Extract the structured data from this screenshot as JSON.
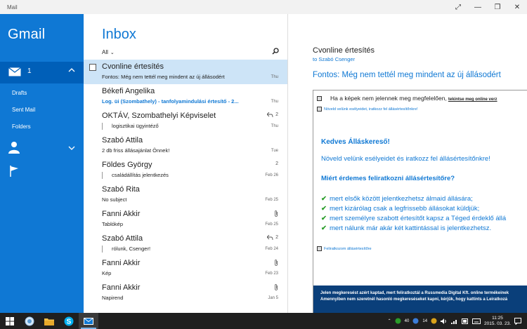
{
  "window": {
    "title": "Mail",
    "controls": [
      "⤢",
      "—",
      "❐",
      "✕"
    ]
  },
  "nav": {
    "account": "Gmail",
    "inbox_count": "1",
    "folders": [
      "Drafts",
      "Sent Mail",
      "Folders"
    ],
    "accent": "#0f78d4"
  },
  "list": {
    "heading": "Inbox",
    "filter": "All",
    "messages": [
      {
        "sender": "Cvonline értesítés",
        "subject": "Fontos: Még nem tettél meg mindent az új állásodért",
        "date": "Thu",
        "count": "",
        "selected": true,
        "unread": false
      },
      {
        "sender": "Békefi Angelika",
        "subject": "Log. üi (Szombathely) - tanfolyamindulási értesítő - 2...",
        "date": "Thu",
        "count": "",
        "selected": false,
        "unread": true
      },
      {
        "sender": "OKTÁV, Szombathelyi Képviselet",
        "subject": "logisztikai ügyintéző",
        "date": "Thu",
        "count": "2",
        "selected": false,
        "unread": false
      },
      {
        "sender": "Szabó Attila",
        "subject": "2 db friss állásajánlat Önnek!",
        "date": "Tue",
        "count": "",
        "selected": false,
        "unread": false
      },
      {
        "sender": "Földes György",
        "subject": "családállítás jelentkezés",
        "date": "Feb 26",
        "count": "2",
        "selected": false,
        "unread": false
      },
      {
        "sender": "Szabó Rita",
        "subject": "No subject",
        "date": "Feb 25",
        "count": "",
        "selected": false,
        "unread": false
      },
      {
        "sender": "Fanni Akkir",
        "subject": "Tablókép",
        "date": "Feb 25",
        "count": "",
        "selected": false,
        "unread": false
      },
      {
        "sender": "Szabó Attila",
        "subject": "rólunk, Csenger!",
        "date": "Feb 24",
        "count": "2",
        "selected": false,
        "unread": false
      },
      {
        "sender": "Fanni Akkir",
        "subject": "Kép",
        "date": "Feb 23",
        "count": "",
        "selected": false,
        "unread": false
      },
      {
        "sender": "Fanni Akkir",
        "subject": "Napirend",
        "date": "Jan 5",
        "count": "",
        "selected": false,
        "unread": false
      }
    ]
  },
  "reading": {
    "title": "Cvonline értesítés",
    "to": "to Szabó Csenger",
    "subject": "Fontos: Még nem tettél meg mindent az új állásodért",
    "email": {
      "image_note": "Ha a képek nem jelennek meg megfelelően,",
      "image_link": "tekintse meg online verz",
      "banner_link": "Növeld velünk esélyeidet, iratkozz fel állásértesítőnkre!",
      "greeting": "Kedves Álláskereső!",
      "para": "Növeld velünk esélyeidet és iratkozz fel állásértesítőnkre!",
      "why": "Miért érdemes feliratkozni állásértesítőre?",
      "bullets": [
        "mert elsők között jelentkezhetsz álmaid állására;",
        "mert kizárólag csak a legfrissebb állásokat küldjük;",
        "mert személyre szabott értesítőt kapsz a Téged érdeklő állá",
        "mert nálunk már akár két kattintással is jelentkezhetsz."
      ],
      "subscribe_link": "Feliratkozom állásértesítőre",
      "footer_1": "Jelen megkeresést azért kaptad, mert feliratkoztál a Russmedia Digital Kft. online termékeinek",
      "footer_2": "Amennyiben nem szeretnél hasonló megkereséseket kapni, kérjük, hogy kattints a Leiratkozá"
    }
  },
  "taskbar": {
    "tray_a": "40",
    "tray_b": "14",
    "time": "11:25",
    "date": "2015. 03. 23."
  }
}
